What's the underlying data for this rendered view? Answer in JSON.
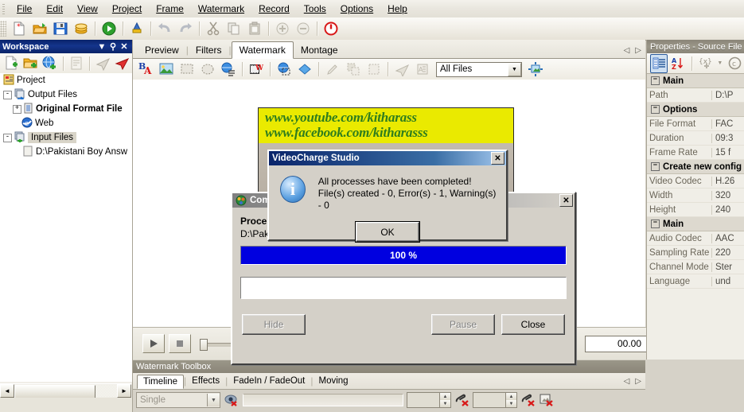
{
  "menubar": {
    "items": [
      "File",
      "Edit",
      "View",
      "Project",
      "Frame",
      "Watermark",
      "Record",
      "Tools",
      "Options",
      "Help"
    ]
  },
  "workspace": {
    "title": "Workspace",
    "tree": [
      {
        "label": "Project",
        "icon": "project-icon",
        "expander": "",
        "indent": 0,
        "bold": false,
        "selected": false
      },
      {
        "label": "Output Files",
        "icon": "folder-out-icon",
        "expander": "-",
        "indent": 1,
        "bold": false,
        "selected": false
      },
      {
        "label": "Original Format File",
        "icon": "document-icon",
        "expander": "+",
        "indent": 2,
        "bold": true,
        "selected": false
      },
      {
        "label": "Web",
        "icon": "web-icon",
        "expander": "",
        "indent": 2,
        "bold": false,
        "selected": false
      },
      {
        "label": "Input Files",
        "icon": "folder-in-icon",
        "expander": "-",
        "indent": 1,
        "bold": false,
        "selected": true
      },
      {
        "label": "D:\\Pakistani Boy Answ",
        "icon": "file-icon",
        "expander": "",
        "indent": 2,
        "bold": false,
        "selected": false
      }
    ]
  },
  "center": {
    "tabs": [
      "Preview",
      "Filters",
      "Watermark",
      "Montage"
    ],
    "active_tab": "Watermark",
    "filter_combo": "All Files",
    "time_value": "00.00"
  },
  "preview": {
    "watermark_line1": "www.youtube.com/kitharass",
    "watermark_line2": "www.facebook.com/kitharasss"
  },
  "properties": {
    "title": "Properties - Source File",
    "rows": [
      {
        "type": "category",
        "name": "Main",
        "value": ""
      },
      {
        "type": "prop",
        "name": "Path",
        "value": "D:\\P"
      },
      {
        "type": "category",
        "name": "Options",
        "value": ""
      },
      {
        "type": "prop",
        "name": "File Format",
        "value": "FAC"
      },
      {
        "type": "prop",
        "name": "Duration",
        "value": "09:3"
      },
      {
        "type": "prop",
        "name": "Frame Rate",
        "value": "15 f"
      },
      {
        "type": "category",
        "name": "Create new config",
        "value": ""
      },
      {
        "type": "prop",
        "name": "Video Codec",
        "value": "H.26"
      },
      {
        "type": "prop",
        "name": "Width",
        "value": "320"
      },
      {
        "type": "prop",
        "name": "Height",
        "value": "240"
      },
      {
        "type": "category",
        "name": "Main",
        "value": ""
      },
      {
        "type": "prop",
        "name": "Audio Codec",
        "value": "AAC"
      },
      {
        "type": "prop",
        "name": "Sampling Rate",
        "value": "220"
      },
      {
        "type": "prop",
        "name": "Channel Mode",
        "value": "Ster"
      },
      {
        "type": "prop",
        "name": "Language",
        "value": "und"
      }
    ]
  },
  "watermark_toolbox": {
    "title": "Watermark Toolbox",
    "tabs": [
      "Timeline",
      "Effects",
      "FadeIn / FadeOut",
      "Moving"
    ],
    "active_tab": "Timeline",
    "mode_combo": "Single"
  },
  "progress_dialog": {
    "title": "Comp",
    "heading": "Proces",
    "path": "D:\\Paki",
    "progress_percent": 100,
    "progress_label": "100 %",
    "buttons": {
      "hide": "Hide",
      "pause": "Pause",
      "close": "Close"
    },
    "close_x": "✕"
  },
  "message_dialog": {
    "title": "VideoCharge Studio",
    "line1": "All processes have been completed!",
    "line2": "File(s) created - 0, Error(s) - 1, Warning(s) - 0",
    "ok_label": "OK",
    "close_x": "✕"
  },
  "colors": {
    "title_active": "#0a246a",
    "progress_fill": "#0000e0",
    "watermark_bg": "#eaea00",
    "watermark_fg": "#2e7d1e",
    "dialog_face": "#d4d0c8"
  }
}
